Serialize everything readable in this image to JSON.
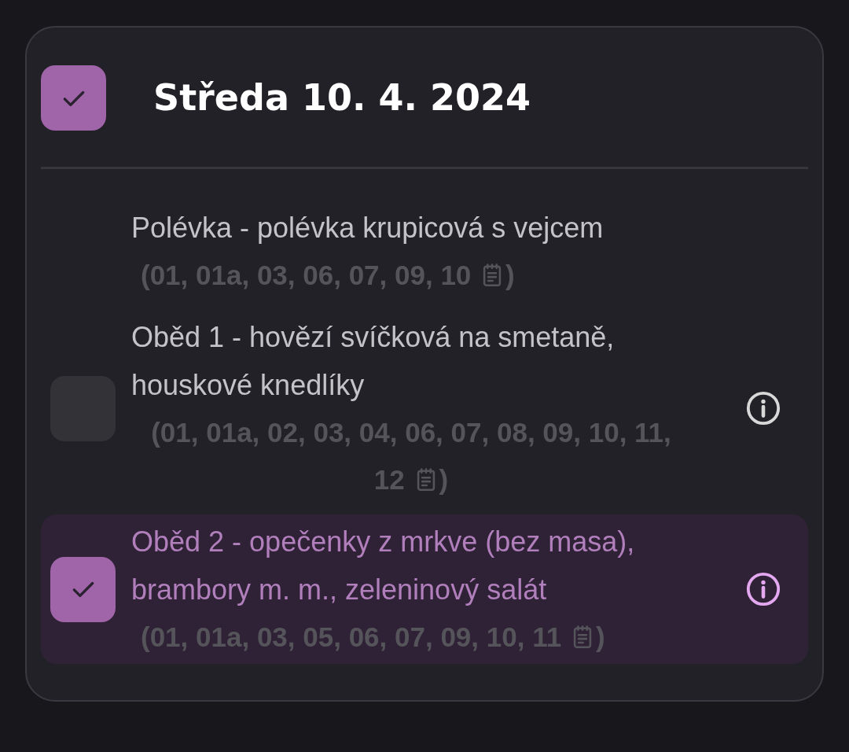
{
  "day": {
    "title": "Středa 10. 4. 2024",
    "checked": true
  },
  "items": [
    {
      "kind": "soup",
      "name": "Polévka - polévka krupicová s vejcem",
      "allergens": [
        "(01, 01a, 03, 06, 07, 09, 10"
      ],
      "close": ")"
    },
    {
      "kind": "meal",
      "name": "Oběd 1 - hovězí svíčková na smetaně, houskové knedlíky",
      "allergens": [
        "(01, 01a, 02, 03, 04, 06, 07, 08, 09, 10, 11,",
        "12"
      ],
      "close": ")",
      "checked": false,
      "selected": false
    },
    {
      "kind": "meal",
      "name": "Oběd 2 - opečenky z mrkve (bez masa), brambory m. m., zeleninový salát",
      "allergens": [
        "(01, 01a, 03, 05, 06, 07, 09, 10, 11"
      ],
      "close": ")",
      "checked": true,
      "selected": true
    }
  ]
}
